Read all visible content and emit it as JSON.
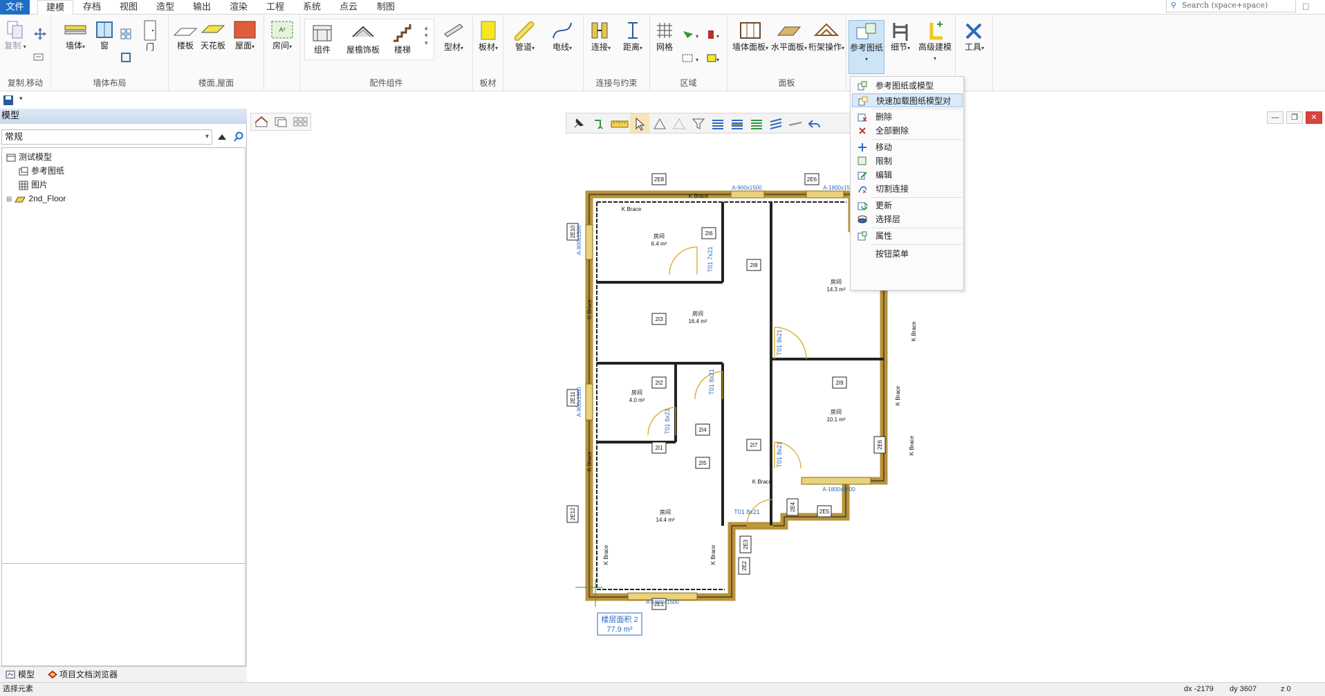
{
  "menu": {
    "tabs": [
      {
        "label": "文件"
      },
      {
        "label": "建模"
      },
      {
        "label": "存档"
      },
      {
        "label": "视图"
      },
      {
        "label": "造型"
      },
      {
        "label": "输出"
      },
      {
        "label": "渲染"
      },
      {
        "label": "工程"
      },
      {
        "label": "系统"
      },
      {
        "label": "点云"
      },
      {
        "label": "制图"
      }
    ],
    "active_tab": "建模",
    "search_placeholder": "Search (space+space)"
  },
  "ribbon": {
    "groups": [
      {
        "label": "复制,移动",
        "buttons": [
          "复制"
        ]
      },
      {
        "label": "墙体布局",
        "buttons": [
          "墙体",
          "窗",
          "门"
        ]
      },
      {
        "label": "楼面,屋面",
        "buttons": [
          "楼板",
          "天花板",
          "屋面"
        ]
      },
      {
        "label": "",
        "buttons": [
          "房间"
        ]
      },
      {
        "label": "配件组件",
        "buttons": [
          "组件",
          "屋檐饰板",
          "楼梯",
          "型材"
        ]
      },
      {
        "label": "板材",
        "buttons": [
          "板材"
        ]
      },
      {
        "label": "",
        "buttons": [
          "管道",
          "电线"
        ]
      },
      {
        "label": "连接与约束",
        "buttons": [
          "连接",
          "距离"
        ]
      },
      {
        "label": "区域",
        "buttons": [
          "网格"
        ]
      },
      {
        "label": "面板",
        "buttons": [
          "墙体面板",
          "水平面板",
          "桁架操作"
        ]
      },
      {
        "label": "",
        "buttons": [
          "参考图纸",
          "细节",
          "高级建模"
        ]
      },
      {
        "label": "",
        "buttons": [
          "工具"
        ]
      }
    ]
  },
  "left_panel": {
    "title": "模型",
    "filter": "常规",
    "tree": [
      {
        "label": "测试模型",
        "icon": "model-icon"
      },
      {
        "label": "参考图纸",
        "icon": "reference-drawing-icon"
      },
      {
        "label": "图片",
        "icon": "picture-icon"
      },
      {
        "label": "2nd_Floor",
        "icon": "floor-icon"
      }
    ],
    "bottom_tabs": [
      {
        "label": "模型",
        "icon": "model-tab-icon"
      },
      {
        "label": "项目文档浏览器",
        "icon": "project-browser-icon"
      }
    ]
  },
  "context_menu": {
    "items": [
      {
        "label": "参考图纸或模型",
        "icon": "reference-add-icon"
      },
      {
        "label": "快速加载图纸模型对",
        "icon": "quick-load-icon",
        "highlighted": true
      },
      {
        "label": "删除",
        "icon": "delete-icon"
      },
      {
        "label": "全部删除",
        "icon": "delete-all-icon"
      },
      {
        "label": "移动",
        "icon": "move-icon"
      },
      {
        "label": "限制",
        "icon": "restrict-icon"
      },
      {
        "label": "编辑",
        "icon": "edit-icon"
      },
      {
        "label": "切割连接",
        "icon": "cut-connection-icon"
      },
      {
        "label": "更新",
        "icon": "update-icon"
      },
      {
        "label": "选择层",
        "icon": "select-layer-icon"
      },
      {
        "label": "属性",
        "icon": "properties-icon"
      },
      {
        "label": "按钮菜单",
        "icon": "button-menu-icon"
      }
    ]
  },
  "floorplan": {
    "tags": [
      "2E8",
      "2E6",
      "2E10",
      "2E11",
      "2E12",
      "2E1",
      "2E3",
      "2E2",
      "2E4",
      "2E5",
      "2E6",
      "2I3",
      "2I6",
      "2I8",
      "2I9",
      "2I2",
      "2I4",
      "2I1",
      "2I5",
      "2I7"
    ],
    "window_labels": [
      "A-900x1500",
      "A-1800x1500",
      "A-900x1500",
      "A-900x1500",
      "A-1800x1500",
      "A-1800x1500"
    ],
    "door_labels": [
      "T01 7x21",
      "T01 9x21",
      "T01 8x21",
      "T01 8x21",
      "T01 8x21",
      "T01 8x21"
    ],
    "brace_label": "K Brace",
    "rooms": [
      {
        "name": "房间",
        "area": "6.4 m²"
      },
      {
        "name": "房间",
        "area": "16.4 m²"
      },
      {
        "name": "房间",
        "area": "4.0 m²"
      },
      {
        "name": "房间",
        "area": "14.4 m²"
      },
      {
        "name": "房间",
        "area": "14.3 m²"
      },
      {
        "name": "房间",
        "area": "10.1 m²"
      }
    ],
    "total_label": "楼层面积 2",
    "total_area": "77.9 m²"
  },
  "statusbar": {
    "left": "选择元素",
    "dx": "dx -2179",
    "dy": "dy 3607",
    "z": "z 0"
  },
  "colors": {
    "accent": "#1e6fc4",
    "wall_fill": "#b8933c",
    "wall_line": "#111111",
    "window": "#e8d27a",
    "door": "#d4a017",
    "highlight": "#dbeaf8",
    "close": "#d9433b"
  }
}
